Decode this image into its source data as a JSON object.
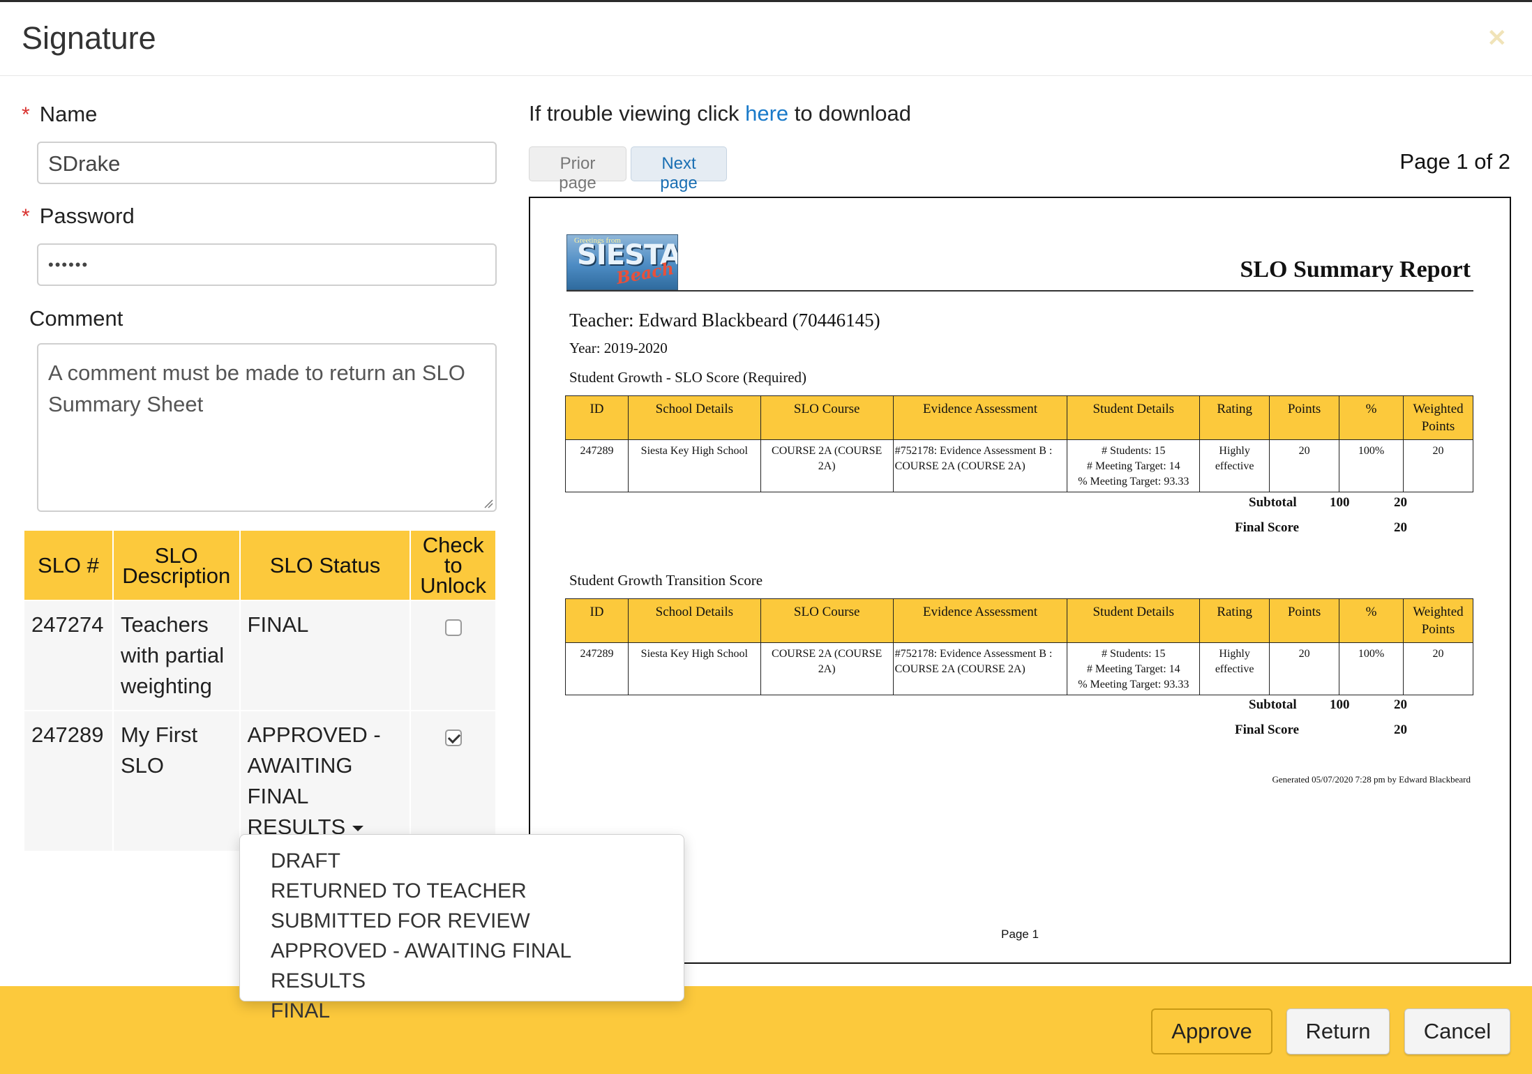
{
  "dialog": {
    "title": "Signature",
    "close_icon": "close-icon"
  },
  "form": {
    "name_label": "Name",
    "name_value": "SDrake",
    "password_label": "Password",
    "password_value": "••••••",
    "comment_label": "Comment",
    "comment_placeholder": "A comment must be made to return an SLO Summary Sheet",
    "required_mark": "*"
  },
  "slo_table": {
    "headers": [
      "SLO #",
      "SLO Description",
      "SLO Status",
      "Check to Unlock"
    ],
    "rows": [
      {
        "id": "247274",
        "description": "Teachers with partial weighting",
        "status": "FINAL",
        "checked": false
      },
      {
        "id": "247289",
        "description": "My First SLO",
        "status": "APPROVED - AWAITING FINAL RESULTS",
        "checked": true
      }
    ]
  },
  "status_dropdown": {
    "options": [
      "DRAFT",
      "RETURNED TO TEACHER",
      "SUBMITTED FOR REVIEW",
      "APPROVED - AWAITING FINAL RESULTS",
      "FINAL"
    ]
  },
  "viewer": {
    "trouble_prefix": "If trouble viewing click ",
    "trouble_link": "here",
    "trouble_suffix": " to download",
    "prior_label": "Prior page",
    "next_label": "Next page",
    "page_info": "Page 1 of 2"
  },
  "report": {
    "logo_text_main": "SIESTA",
    "logo_text_script": "Beach",
    "logo_text_top": "Greetings from",
    "title": "SLO Summary Report",
    "teacher": "Teacher: Edward Blackbeard (70446145)",
    "year": "Year: 2019-2020",
    "section1": "Student Growth - SLO Score (Required)",
    "section2": "Student Growth Transition Score",
    "columns": [
      "ID",
      "School Details",
      "SLO Course",
      "Evidence Assessment",
      "Student Details",
      "Rating",
      "Points",
      "%",
      "Weighted Points"
    ],
    "row": {
      "id": "247289",
      "school": "Siesta Key High School",
      "course": "COURSE 2A (COURSE 2A)",
      "evidence": "#752178: Evidence Assessment B : COURSE 2A (COURSE 2A)",
      "students": "# Students: 15",
      "meeting": "# Meeting Target: 14",
      "pct_meeting": "% Meeting Target: 93.33",
      "rating": "Highly effective",
      "points": "20",
      "percent": "100%",
      "weighted": "20"
    },
    "subtotal_label": "Subtotal",
    "subtotal_value": "100",
    "subtotal_weighted": "20",
    "final_label": "Final Score",
    "final_value": "20",
    "generated": "Generated 05/07/2020 7:28 pm by Edward Blackbeard",
    "page_footer": "Page 1"
  },
  "footer": {
    "approve": "Approve",
    "return": "Return",
    "cancel": "Cancel"
  },
  "colors": {
    "accent": "#fcc93c",
    "link": "#1a7ac9",
    "required": "#d9322f"
  }
}
